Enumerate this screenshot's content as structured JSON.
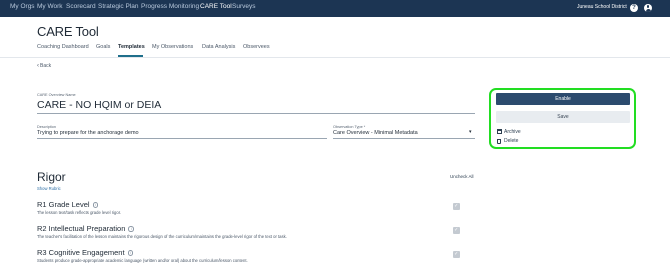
{
  "topnav": {
    "items": [
      "My Orgs",
      "My Work",
      "Scorecard",
      "Strategic Plan",
      "Progress Monitoring",
      "CARE Tool",
      "Surveys"
    ],
    "district": "Juneau School District",
    "help_glyph": "?"
  },
  "app": {
    "title": "CARE Tool"
  },
  "tabs": [
    "Coaching Dashboard",
    "Goals",
    "Templates",
    "My Observations",
    "Data Analysis",
    "Observees"
  ],
  "active_tab": "Templates",
  "back": {
    "label": "Back"
  },
  "form": {
    "name_label": "CARE Overview Name",
    "name_value": "CARE - NO HQIM or DEIA",
    "description_label": "Description",
    "description_value": "Trying to prepare for the anchorage demo",
    "type_label": "Observation Type *",
    "type_value": "Care Overview - Minimal Metadata"
  },
  "actions": {
    "enable": "Enable",
    "save": "Save",
    "archive": "Archive",
    "delete": "Delete"
  },
  "section": {
    "title": "Rigor",
    "show_rubric": "Show Rubric",
    "uncheck_all": "Uncheck All",
    "criteria": [
      {
        "title": "R1 Grade Level",
        "description": "The lesson text/task reflects grade level rigor."
      },
      {
        "title": "R2 Intellectual Preparation",
        "description": "The teacher's facilitation of the lesson maintains the rigorous design of the curriculum/maintains the grade-level rigor of the text or task."
      },
      {
        "title": "R3 Cognitive Engagement",
        "description": "Students produce grade-appropriate academic language (written and/or oral) about the curriculum/lesson content."
      }
    ]
  },
  "icons": {
    "help": "help-icon",
    "user": "user-icon",
    "back": "chevron-left-icon",
    "archive": "archive-icon",
    "delete": "trash-icon",
    "info": "info-icon",
    "check": "checkbox-icon"
  },
  "colors": {
    "nav_bg": "#1c3553",
    "primary": "#2c4b6e",
    "highlight": "#22dd22",
    "link": "#2d6fa6"
  }
}
